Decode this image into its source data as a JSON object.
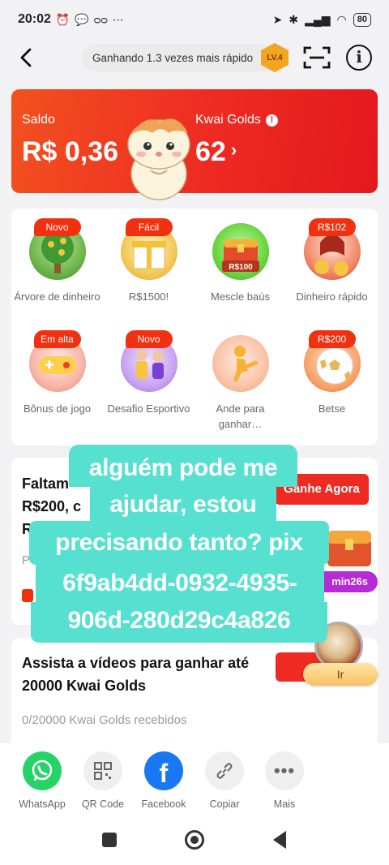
{
  "status_bar": {
    "time": "20:02",
    "battery": "80"
  },
  "header": {
    "speed_text": "Ganhando 1.3 vezes mais rápido",
    "level": "LV.4"
  },
  "balance": {
    "saldo_label": "Saldo",
    "saldo_value": "R$ 0,36",
    "golds_label": "Kwai Golds",
    "golds_value": "62"
  },
  "games": [
    {
      "tag": "Novo",
      "label": "Árvore de dinheiro",
      "icon": "money-tree"
    },
    {
      "tag": "Fácil",
      "label": "R$1500!",
      "icon": "gift-box"
    },
    {
      "tag": "",
      "label": "Mescle baús",
      "icon": "treasure-chest",
      "badge": "R$100"
    },
    {
      "tag": "R$102",
      "label": "Dinheiro rápido",
      "icon": "coin-girl"
    },
    {
      "tag": "Em alta",
      "label": "Bônus de jogo",
      "icon": "gamepad"
    },
    {
      "tag": "Novo",
      "label": "Desafio Esportivo",
      "icon": "sports-players"
    },
    {
      "tag": "",
      "label": "Ande para ganhar…",
      "icon": "walking-figure"
    },
    {
      "tag": "R$200",
      "label": "Betse",
      "icon": "soccer-ball"
    }
  ],
  "task": {
    "title": "Faltam … R$200, c… R…",
    "title_l1": "Faltam",
    "title_l2": "R$200, c",
    "title_l3": "R",
    "p_text": "P",
    "button": "Ganhe Agora",
    "timer": "min26s"
  },
  "video": {
    "title": "Assista a vídeos para ganhar até 20000 Kwai Golds",
    "subtitle": "0/20000 Kwai Golds recebidos",
    "button": "Ir"
  },
  "share": [
    {
      "label": "WhatsApp",
      "icon": "whatsapp-icon",
      "color": "#25d366"
    },
    {
      "label": "QR Code",
      "icon": "qrcode-icon",
      "color": "#f0f0f0"
    },
    {
      "label": "Facebook",
      "icon": "facebook-icon",
      "color": "#1877f2"
    },
    {
      "label": "Copiar",
      "icon": "link-icon",
      "color": "#f0f0f0"
    },
    {
      "label": "Mais",
      "icon": "more-icon",
      "color": "#f0f0f0"
    }
  ],
  "overlay": {
    "lines": [
      "alguém pode me",
      "ajudar, estou",
      "precisando tanto? pix",
      "6f9ab4dd-0932-4935-",
      "906d-280d29c4a826"
    ],
    "color": "#55e0cf"
  },
  "colors": {
    "primary": "#ee2a22",
    "tag": "#f0300f",
    "accent_purple": "#b72ad7"
  }
}
